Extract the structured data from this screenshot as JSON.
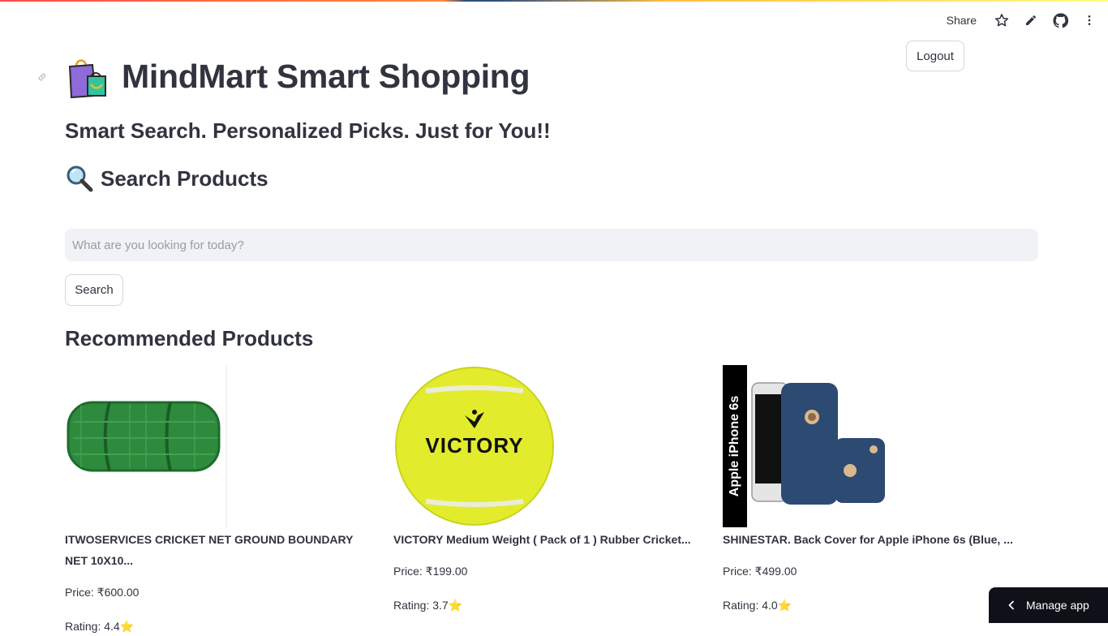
{
  "toolbar": {
    "share_label": "Share",
    "icons": [
      "star-icon",
      "pencil-icon",
      "github-icon",
      "more-vert-icon"
    ]
  },
  "header": {
    "logout_label": "Logout",
    "title": "MindMart Smart Shopping",
    "title_icon": "shopping-bags-icon",
    "tagline": "Smart Search. Personalized Picks. Just for You!!"
  },
  "search": {
    "section_title": "Search Products",
    "section_icon": "magnifying-glass-icon",
    "placeholder": "What are you looking for today?",
    "value": "",
    "button_label": "Search"
  },
  "recommended": {
    "title": "Recommended Products",
    "products": [
      {
        "name": "ITWOSERVICES CRICKET NET GROUND BOUNDARY NET 10X10...",
        "price": "Price: ₹600.00",
        "rating": "Rating: 4.4⭐",
        "image_icon": "cricket-net-image"
      },
      {
        "name": "VICTORY Medium Weight ( Pack of 1 ) Rubber Cricket...",
        "price": "Price: ₹199.00",
        "rating": "Rating: 3.7⭐",
        "image_icon": "tennis-ball-image",
        "image_text": "VICTORY"
      },
      {
        "name": "SHINESTAR. Back Cover for Apple iPhone 6s  (Blue, ...",
        "price": "Price: ₹499.00",
        "rating": "Rating: 4.0⭐",
        "image_icon": "phone-cover-image",
        "image_text": "Apple iPhone 6s"
      }
    ]
  },
  "footer": {
    "manage_label": "Manage app"
  },
  "colors": {
    "text": "#31333f",
    "input_bg": "#f0f2f6",
    "manage_bg": "#0e1117",
    "net_green": "#2e8b3e",
    "ball_yellow": "#e3ec2c",
    "cover_blue": "#2c4a72"
  }
}
